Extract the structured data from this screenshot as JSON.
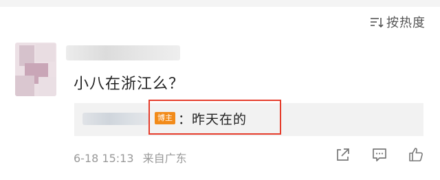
{
  "sort": {
    "label": "按热度",
    "icon": "sort-icon"
  },
  "comment": {
    "text": "小八在浙江么？"
  },
  "reply": {
    "badge": "博主",
    "text": "：昨天在的"
  },
  "meta": {
    "time": "6-18 15:13",
    "source": "来自广东"
  },
  "actions": [
    {
      "name": "share-icon"
    },
    {
      "name": "comment-icon"
    },
    {
      "name": "like-icon"
    }
  ],
  "colors": {
    "highlight": "#e53c2b",
    "badge": "#f28b1a",
    "reply_bg": "#f2f2f2",
    "meta_text": "#999999"
  }
}
